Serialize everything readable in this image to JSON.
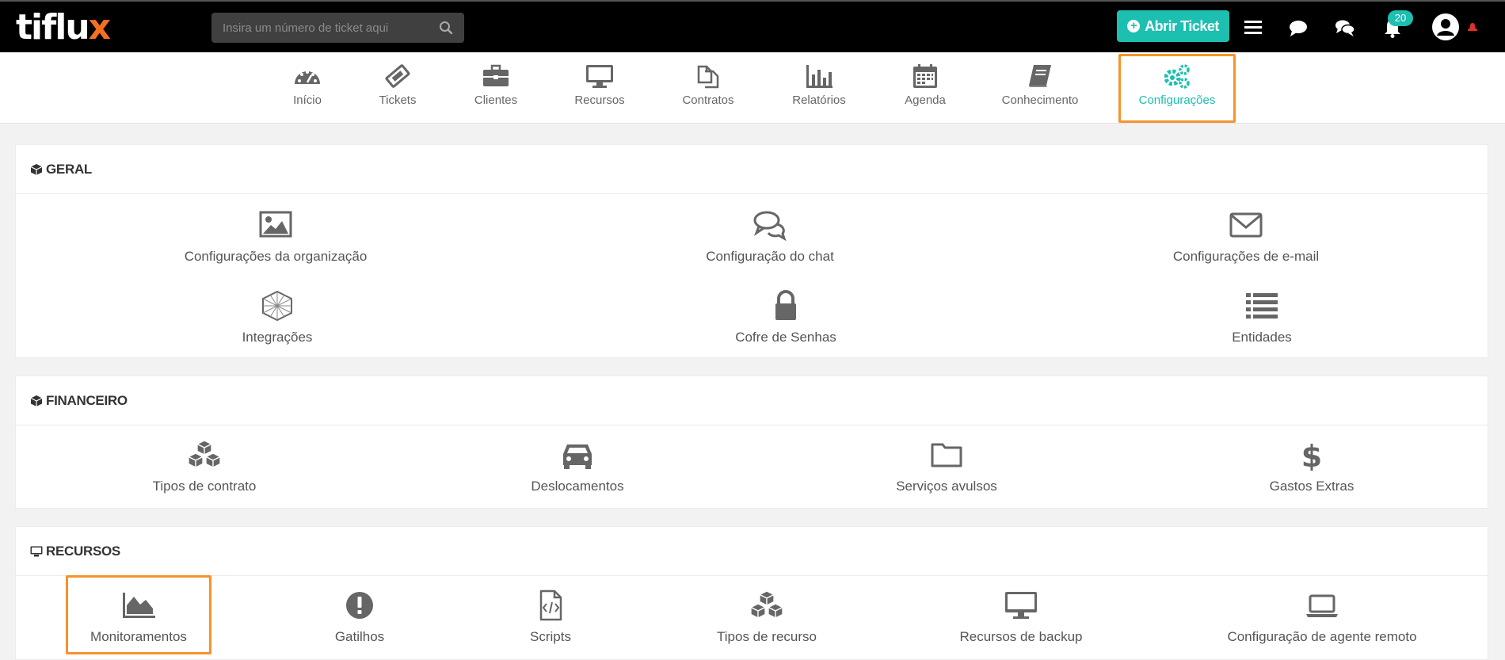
{
  "app": {
    "logo_text": "tiflu",
    "logo_x": "x"
  },
  "topbar": {
    "search_placeholder": "Insira um número de ticket aqui",
    "open_ticket_label": "Abrir Ticket",
    "notification_count": "20",
    "accent_color": "#1cbfb0"
  },
  "nav": {
    "items": [
      {
        "label": "Início",
        "icon": "dashboard-icon"
      },
      {
        "label": "Tickets",
        "icon": "ticket-icon"
      },
      {
        "label": "Clientes",
        "icon": "briefcase-icon"
      },
      {
        "label": "Recursos",
        "icon": "monitor-icon"
      },
      {
        "label": "Contratos",
        "icon": "copy-icon"
      },
      {
        "label": "Relatórios",
        "icon": "bar-chart-icon"
      },
      {
        "label": "Agenda",
        "icon": "calendar-icon"
      },
      {
        "label": "Conhecimento",
        "icon": "book-icon"
      },
      {
        "label": "Configurações",
        "icon": "gears-icon"
      }
    ],
    "active": "Configurações",
    "highlight_color": "#f7922b"
  },
  "sections": {
    "geral": {
      "title": "GERAL",
      "items": [
        {
          "label": "Configurações da organização",
          "icon": "image-icon"
        },
        {
          "label": "Configuração do chat",
          "icon": "chat-icon"
        },
        {
          "label": "Configurações de e-mail",
          "icon": "envelope-icon"
        },
        {
          "label": "Integrações",
          "icon": "hexagon-icon"
        },
        {
          "label": "Cofre de Senhas",
          "icon": "lock-icon"
        },
        {
          "label": "Entidades",
          "icon": "list-icon"
        }
      ]
    },
    "financeiro": {
      "title": "FINANCEIRO",
      "items": [
        {
          "label": "Tipos de contrato",
          "icon": "cubes-icon"
        },
        {
          "label": "Deslocamentos",
          "icon": "car-icon"
        },
        {
          "label": "Serviços avulsos",
          "icon": "folder-icon"
        },
        {
          "label": "Gastos Extras",
          "icon": "dollar-icon"
        }
      ]
    },
    "recursos": {
      "title": "RECURSOS",
      "items": [
        {
          "label": "Monitoramentos",
          "icon": "area-chart-icon"
        },
        {
          "label": "Gatilhos",
          "icon": "exclamation-icon"
        },
        {
          "label": "Scripts",
          "icon": "code-file-icon"
        },
        {
          "label": "Tipos de recurso",
          "icon": "cubes-icon"
        },
        {
          "label": "Recursos de backup",
          "icon": "desktop-icon"
        },
        {
          "label": "Configuração de agente remoto",
          "icon": "laptop-icon"
        }
      ]
    }
  }
}
